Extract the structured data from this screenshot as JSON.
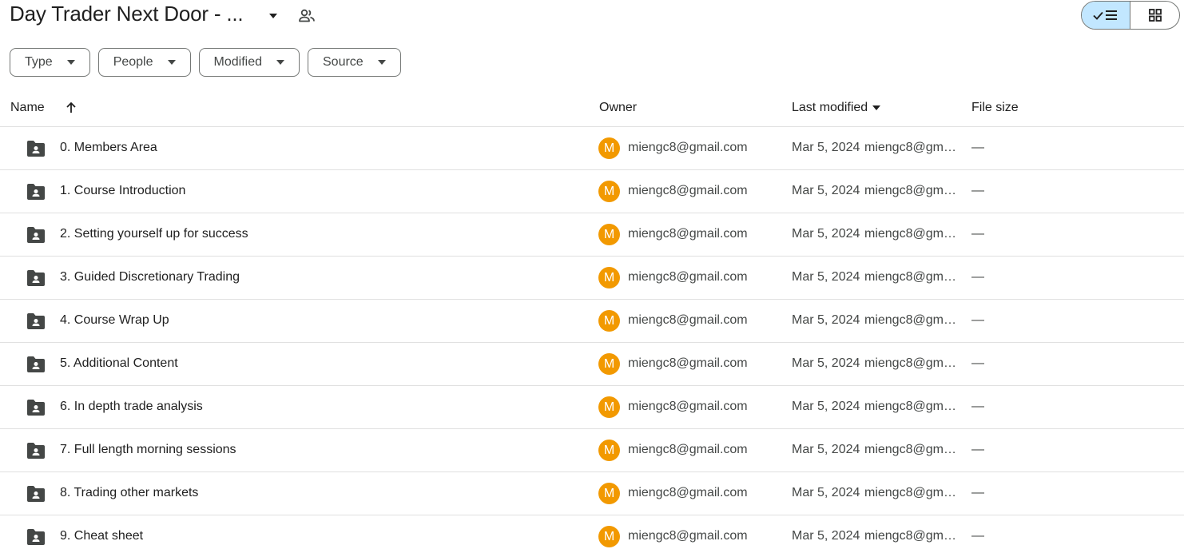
{
  "header": {
    "title": "Day Trader Next Door - ..."
  },
  "view_toggle": {
    "active": "list"
  },
  "filters": [
    {
      "label": "Type"
    },
    {
      "label": "People"
    },
    {
      "label": "Modified"
    },
    {
      "label": "Source"
    }
  ],
  "table": {
    "columns": {
      "name": "Name",
      "owner": "Owner",
      "last_modified": "Last modified",
      "file_size": "File size"
    },
    "rows": [
      {
        "name": "0. Members Area",
        "owner_initial": "M",
        "owner": "miengc8@gmail.com",
        "modified_date": "Mar 5, 2024",
        "modified_by": "miengc8@gmail.com",
        "size": "—"
      },
      {
        "name": "1. Course Introduction",
        "owner_initial": "M",
        "owner": "miengc8@gmail.com",
        "modified_date": "Mar 5, 2024",
        "modified_by": "miengc8@gmail.com",
        "size": "—"
      },
      {
        "name": "2. Setting yourself up for success",
        "owner_initial": "M",
        "owner": "miengc8@gmail.com",
        "modified_date": "Mar 5, 2024",
        "modified_by": "miengc8@gmail.com",
        "size": "—"
      },
      {
        "name": "3. Guided Discretionary Trading",
        "owner_initial": "M",
        "owner": "miengc8@gmail.com",
        "modified_date": "Mar 5, 2024",
        "modified_by": "miengc8@gmail.com",
        "size": "—"
      },
      {
        "name": "4. Course Wrap Up",
        "owner_initial": "M",
        "owner": "miengc8@gmail.com",
        "modified_date": "Mar 5, 2024",
        "modified_by": "miengc8@gmail.com",
        "size": "—"
      },
      {
        "name": "5. Additional Content",
        "owner_initial": "M",
        "owner": "miengc8@gmail.com",
        "modified_date": "Mar 5, 2024",
        "modified_by": "miengc8@gmail.com",
        "size": "—"
      },
      {
        "name": "6. In depth trade analysis",
        "owner_initial": "M",
        "owner": "miengc8@gmail.com",
        "modified_date": "Mar 5, 2024",
        "modified_by": "miengc8@gmail.com",
        "size": "—"
      },
      {
        "name": "7. Full length morning sessions",
        "owner_initial": "M",
        "owner": "miengc8@gmail.com",
        "modified_date": "Mar 5, 2024",
        "modified_by": "miengc8@gmail.com",
        "size": "—"
      },
      {
        "name": "8. Trading other markets",
        "owner_initial": "M",
        "owner": "miengc8@gmail.com",
        "modified_date": "Mar 5, 2024",
        "modified_by": "miengc8@gmail.com",
        "size": "—"
      },
      {
        "name": "9. Cheat sheet",
        "owner_initial": "M",
        "owner": "miengc8@gmail.com",
        "modified_date": "Mar 5, 2024",
        "modified_by": "miengc8@gmail.com",
        "size": "—"
      }
    ]
  },
  "colors": {
    "avatar": "#f29900",
    "toggle_active": "#c2e7ff",
    "divider": "#e0e0e0",
    "icon": "#444746"
  },
  "icons": {
    "folder": "shared-folder-icon",
    "shared": "people-icon",
    "sort": "arrow-up-icon"
  }
}
